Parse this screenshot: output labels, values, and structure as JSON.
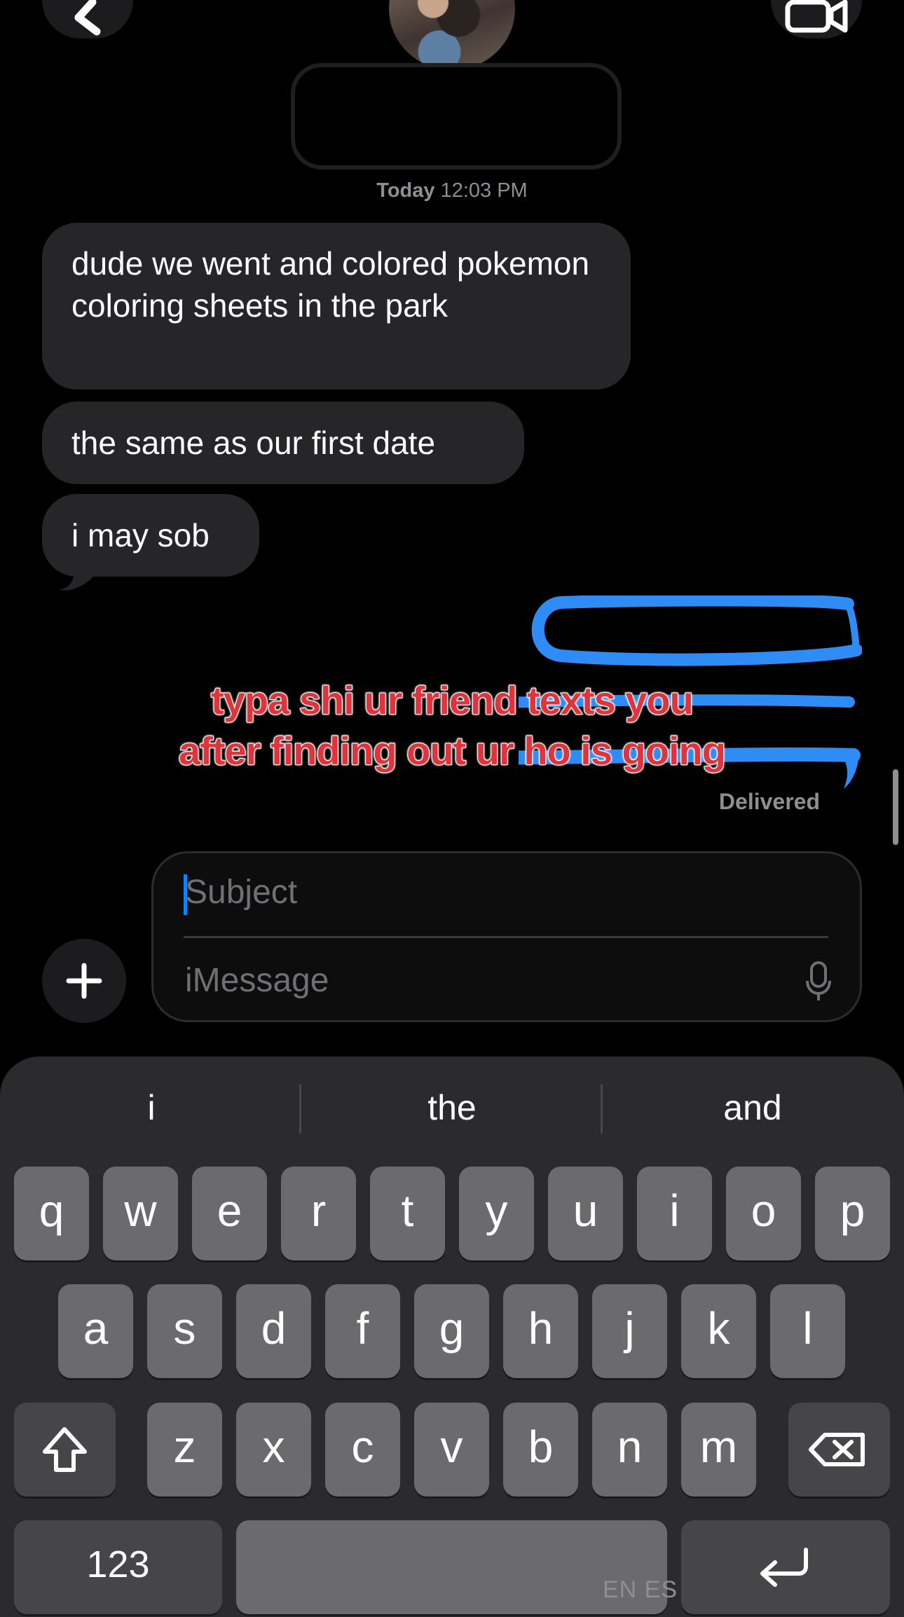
{
  "header": {
    "back_icon": "chevron-left-icon",
    "video_icon": "video-camera-icon"
  },
  "conversation": {
    "timestamp_day": "Today",
    "timestamp_time": "12:03 PM",
    "incoming": [
      "dude we went and colored pokemon coloring sheets in the park",
      "the same as our first date",
      "i may sob"
    ],
    "delivered_label": "Delivered"
  },
  "overlay_caption": "typa shi ur friend texts you after finding out ur ho is going",
  "compose": {
    "subject_placeholder": "Subject",
    "message_placeholder": "iMessage",
    "plus_icon": "plus-icon",
    "mic_icon": "microphone-icon"
  },
  "keyboard": {
    "suggestions": [
      "i",
      "the",
      "and"
    ],
    "row1": [
      "q",
      "w",
      "e",
      "r",
      "t",
      "y",
      "u",
      "i",
      "o",
      "p"
    ],
    "row2": [
      "a",
      "s",
      "d",
      "f",
      "g",
      "h",
      "j",
      "k",
      "l"
    ],
    "row3": [
      "z",
      "x",
      "c",
      "v",
      "b",
      "n",
      "m"
    ],
    "numbers_label": "123",
    "language_label": "EN ES",
    "shift_icon": "shift-icon",
    "delete_icon": "delete-icon",
    "return_icon": "return-icon"
  },
  "colors": {
    "accent": "#0a84ff",
    "incoming_bubble": "#262628",
    "outgoing_bubble": "#2f8cf5",
    "caption_text": "#e0343c"
  }
}
